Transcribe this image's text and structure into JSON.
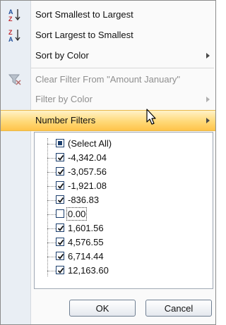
{
  "menu": {
    "sort_asc": "Sort Smallest to Largest",
    "sort_desc": "Sort Largest to Smallest",
    "sort_color": "Sort by Color",
    "clear_filter": "Clear Filter From \"Amount January\"",
    "filter_color": "Filter by Color",
    "number_filters": "Number Filters"
  },
  "icons": {
    "sort_asc_top": "A",
    "sort_asc_bottom": "Z",
    "sort_desc_top": "Z",
    "sort_desc_bottom": "A"
  },
  "filter_list": [
    {
      "label": "(Select All)",
      "state": "partial"
    },
    {
      "label": "-4,342.04",
      "state": "checked"
    },
    {
      "label": "-3,057.56",
      "state": "checked"
    },
    {
      "label": "-1,921.08",
      "state": "checked"
    },
    {
      "label": "-836.83",
      "state": "checked"
    },
    {
      "label": "0.00",
      "state": "unchecked"
    },
    {
      "label": "1,601.56",
      "state": "checked"
    },
    {
      "label": "4,576.55",
      "state": "checked"
    },
    {
      "label": "6,714.44",
      "state": "checked"
    },
    {
      "label": "12,163.60",
      "state": "checked"
    }
  ],
  "buttons": {
    "ok": "OK",
    "cancel": "Cancel"
  },
  "colors": {
    "highlight": "#ffd978",
    "sort_icon_blue": "#1f4e9a",
    "sort_icon_red": "#c0282e",
    "checkbox_border": "#1c3f6e"
  }
}
